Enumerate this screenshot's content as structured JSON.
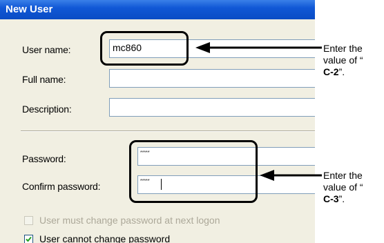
{
  "window": {
    "title": "New User"
  },
  "fields": {
    "username": {
      "label": "User name:",
      "value": "mc860"
    },
    "fullname": {
      "label": "Full name:",
      "value": ""
    },
    "description": {
      "label": "Description:",
      "value": ""
    },
    "password": {
      "label": "Password:",
      "value": "*****"
    },
    "confirm": {
      "label": "Confirm password:",
      "value": "*****"
    }
  },
  "checkboxes": [
    {
      "label": "User must change password at next logon",
      "checked": false,
      "enabled": false
    },
    {
      "label": "User cannot change password",
      "checked": true,
      "enabled": true
    }
  ],
  "annotations": {
    "note1": {
      "line1": "Enter the",
      "line2": "value of “",
      "ref": "C-2",
      "suffix": "”."
    },
    "note2": {
      "line1": "Enter the",
      "line2": "value of “",
      "ref": "C-3",
      "suffix": "”."
    }
  },
  "colors": {
    "titlebar": "#0a4cc4",
    "dialog_bg": "#f1efe2",
    "field_border": "#7f9db9"
  }
}
